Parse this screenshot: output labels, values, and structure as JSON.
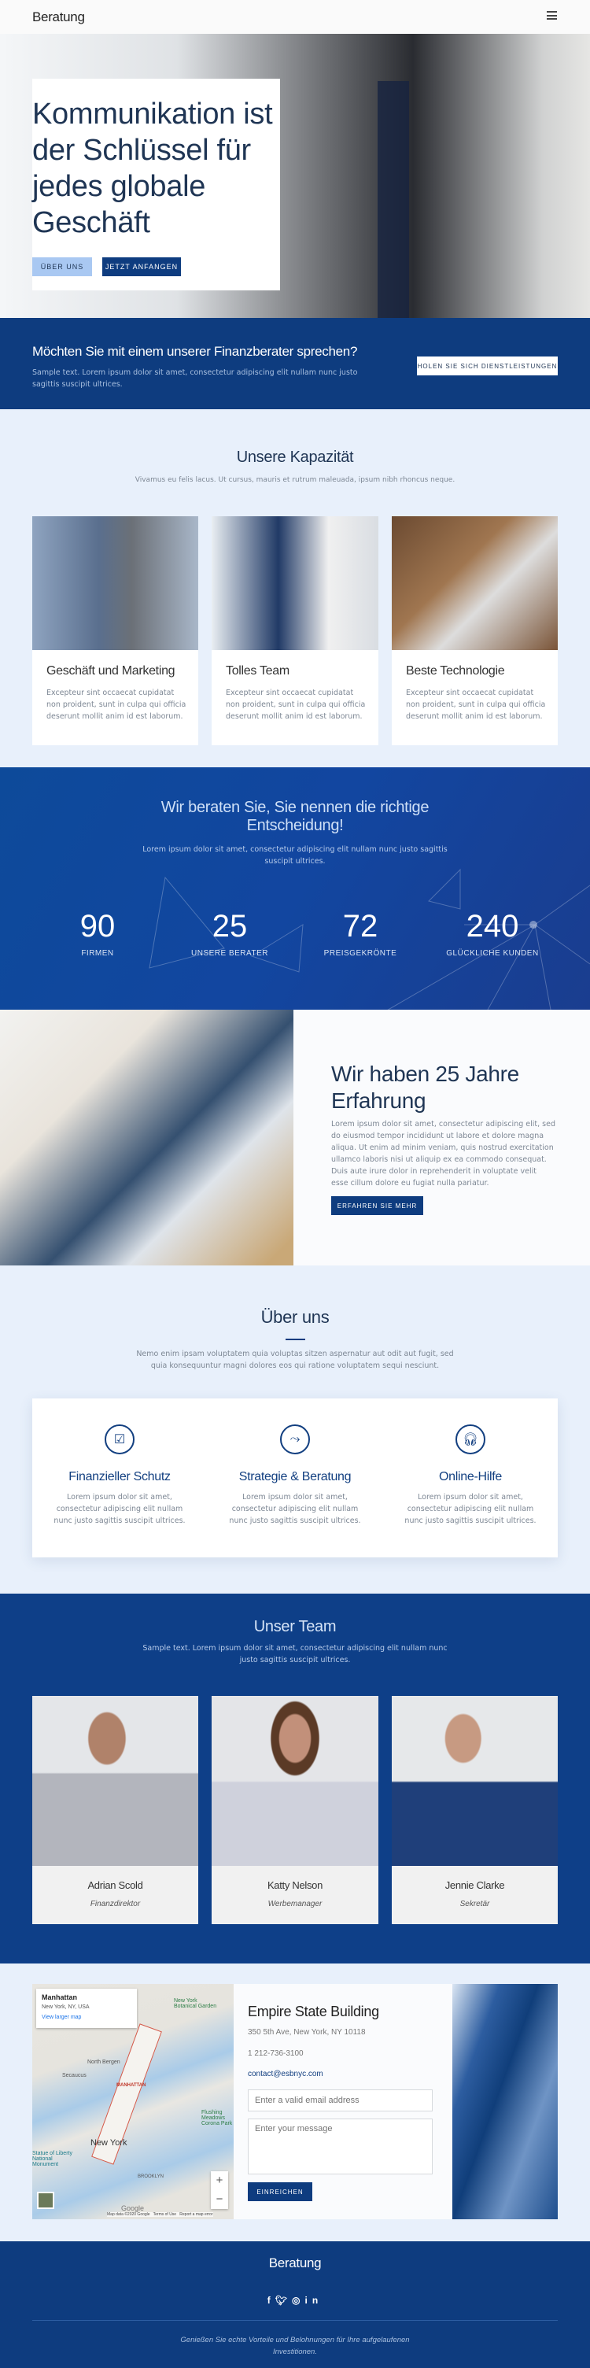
{
  "header": {
    "logo": "Beratung",
    "menu_icon": "hamburger-icon"
  },
  "hero": {
    "title": [
      "Kommunikation ist",
      "der Schlüssel für",
      "jedes globale",
      "Geschäft"
    ],
    "btn_about": "Über uns",
    "btn_start": "Jetzt anfangen"
  },
  "cta": {
    "title": "Möchten Sie mit einem unserer Finanzberater sprechen?",
    "text": "Sample text. Lorem ipsum dolor sit amet, consectetur adipiscing elit nullam nunc justo sagittis suscipit ultrices.",
    "button": "Holen Sie sich Dienstleistungen"
  },
  "capacity": {
    "title": "Unsere Kapazität",
    "subtitle": "Vivamus eu felis lacus. Ut cursus, mauris et rutrum maleuada, ipsum nibh rhoncus neque.",
    "cards": [
      {
        "title": "Geschäft und Marketing",
        "text": "Excepteur sint occaecat cupidatat non proident, sunt in culpa qui officia deserunt mollit anim id est laborum."
      },
      {
        "title": "Tolles Team",
        "text": "Excepteur sint occaecat cupidatat non proident, sunt in culpa qui officia deserunt mollit anim id est laborum."
      },
      {
        "title": "Beste Technologie",
        "text": "Excepteur sint occaecat cupidatat non proident, sunt in culpa qui officia deserunt mollit anim id est laborum."
      }
    ]
  },
  "stats": {
    "title": "Wir beraten Sie, Sie nennen die richtige Entscheidung!",
    "text": "Lorem ipsum dolor sit amet, consectetur adipiscing elit nullam nunc justo sagittis suscipit ultrices.",
    "items": [
      {
        "value": "90",
        "label": "Firmen"
      },
      {
        "value": "25",
        "label": "Unsere Berater"
      },
      {
        "value": "72",
        "label": "Preisgekrönte"
      },
      {
        "value": "240",
        "label": "Glückliche Kunden"
      }
    ]
  },
  "experience": {
    "title": "Wir haben 25 Jahre Erfahrung",
    "text": "Lorem ipsum dolor sit amet, consectetur adipiscing elit, sed do eiusmod tempor incididunt ut labore et dolore magna aliqua. Ut enim ad minim veniam, quis nostrud exercitation ullamco laboris nisi ut aliquip ex ea commodo consequat. Duis aute irure dolor in reprehenderit in voluptate velit esse cillum dolore eu fugiat nulla pariatur.",
    "button": "Erfahren Sie mehr"
  },
  "about": {
    "title": "Über uns",
    "text": "Nemo enim ipsam voluptatem quia voluptas sitzen aspernatur aut odit aut fugit, sed quia konsequuntur magni dolores eos qui ratione voluptatem sequi nesciunt.",
    "features": [
      {
        "icon": "checklist-icon",
        "title": "Finanzieller Schutz",
        "text": "Lorem ipsum dolor sit amet, consectetur adipiscing elit nullam nunc justo sagittis suscipit ultrices."
      },
      {
        "icon": "strategy-icon",
        "title": "Strategie & Beratung",
        "text": "Lorem ipsum dolor sit amet, consectetur adipiscing elit nullam nunc justo sagittis suscipit ultrices."
      },
      {
        "icon": "headset-icon",
        "title": "Online-Hilfe",
        "text": "Lorem ipsum dolor sit amet, consectetur adipiscing elit nullam nunc justo sagittis suscipit ultrices."
      }
    ]
  },
  "team": {
    "title": "Unser Team",
    "text": "Sample text. Lorem ipsum dolor sit amet, consectetur adipiscing elit nullam nunc justo sagittis suscipit ultrices.",
    "members": [
      {
        "name": "Adrian Scold",
        "role": "Finanzdirektor"
      },
      {
        "name": "Katty Nelson",
        "role": "Werbemanager"
      },
      {
        "name": "Jennie Clarke",
        "role": "Sekretär"
      }
    ]
  },
  "contact": {
    "map": {
      "place": "Manhattan",
      "address": "New York, NY, USA",
      "link": "View larger map",
      "labels": [
        "New York",
        "MANHATTAN",
        "BROOKLYN",
        "North Bergen",
        "Secaucus",
        "Flushing Meadows Corona Park",
        "New York Botanical Garden",
        "Statue of Liberty National Monument"
      ],
      "attribution": "Map data ©2020 Google",
      "terms": "Terms of Use",
      "report": "Report a map error",
      "logo": "Google",
      "zoom_in": "+",
      "zoom_out": "−"
    },
    "title": "Empire State Building",
    "address": "350 5th Ave, New York, NY 10118",
    "phone": "1 212-736-3100",
    "email": "contact@esbnyc.com",
    "email_placeholder": "Enter a valid email address",
    "message_placeholder": "Enter your message",
    "submit": "Einreichen"
  },
  "footer": {
    "title": "Beratung",
    "social": [
      "facebook-icon",
      "twitter-icon",
      "instagram-icon",
      "linkedin-icon"
    ],
    "text": "Genießen Sie echte Vorteile und Belohnungen für Ihre aufgelaufenen Investitionen."
  },
  "colors": {
    "navy": "#0e3c7f",
    "light_bg": "#e8f0fb",
    "heading": "#1f3554",
    "accent_light": "#a9c8f2"
  }
}
